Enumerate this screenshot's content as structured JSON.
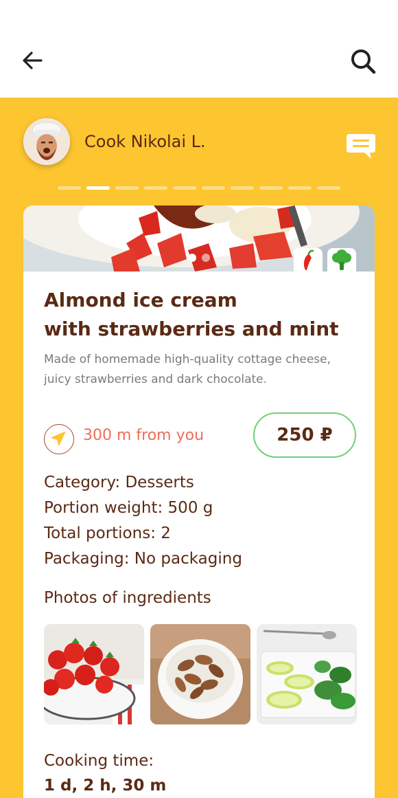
{
  "header": {
    "back_icon": "arrow-left-icon",
    "search_icon": "search-icon"
  },
  "cook": {
    "name": "Cook Nikolai L.",
    "chat_icon": "chat-bubble-icon"
  },
  "pager": {
    "count": 10,
    "active": 1
  },
  "dish": {
    "hero_dots": {
      "count": 2,
      "active": 0
    },
    "tags": [
      "chili-pepper-icon",
      "broccoli-icon"
    ],
    "title_line1": "Almond ice cream",
    "title_line2": "with strawberries and mint",
    "description": "Made of homemade high-quality cottage cheese, juicy strawberries and dark chocolate.",
    "distance": "300 m from you",
    "price": "250 ₽",
    "specs": {
      "category": "Category: Desserts",
      "portion_weight": "Portion weight: 500 g",
      "total_portions": "Total portions: 2",
      "packaging": "Packaging: No packaging"
    },
    "photos_title": "Photos of ingredients",
    "cooking_time_label": "Cooking time:",
    "cooking_time_value": "1 d, 2 h, 30 m"
  },
  "colors": {
    "accent_yellow": "#fdc530",
    "text_brown": "#5a2a14",
    "distance_red": "#ef6e5a",
    "price_border_green": "#6fd07a"
  }
}
